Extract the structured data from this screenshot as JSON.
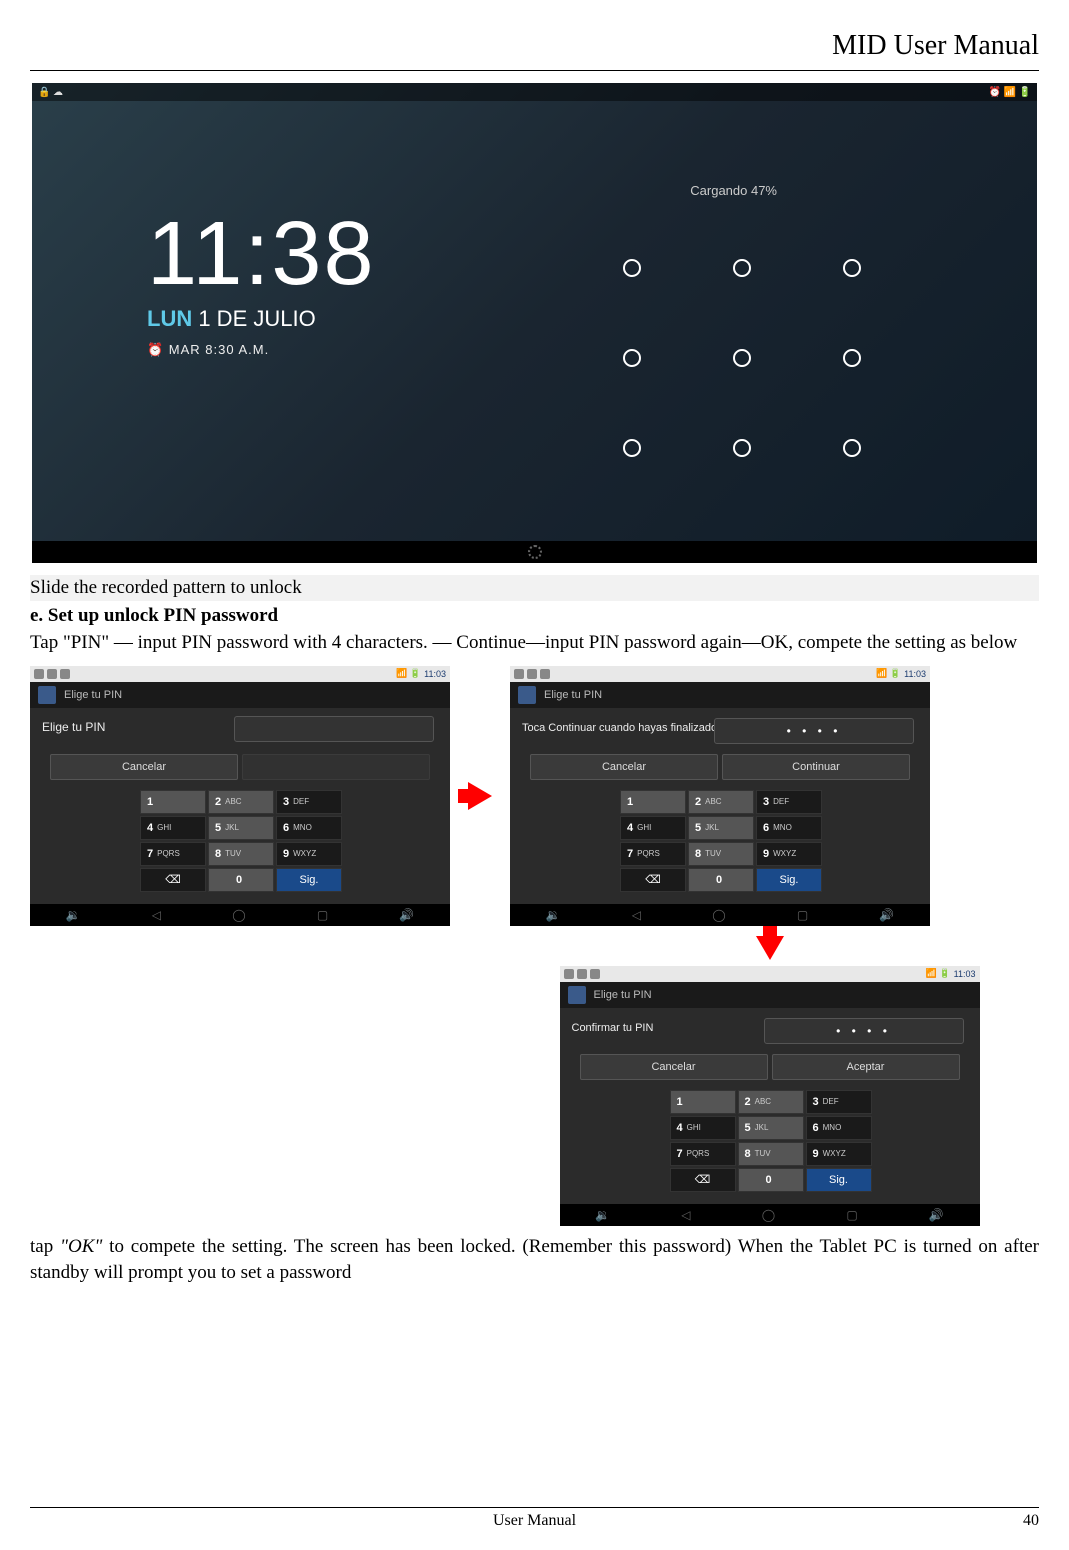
{
  "header_title": "MID User Manual",
  "lockscreen": {
    "time": "11:38",
    "day_prefix": "LUN",
    "date_rest": " 1 DE JULIO",
    "alarm": "⏰ MAR 8:30 A.M.",
    "charging": "Cargando 47%"
  },
  "body": {
    "slide_text": "Slide the recorded pattern to unlock",
    "heading_e": "e. Set up unlock PIN password",
    "para1": "Tap \"PIN\" — input PIN password with 4 characters. — Continue—input PIN password again—OK, compete the setting as below",
    "para2_pre": "tap ",
    "para2_em": "\"OK\"",
    "para2_post": " to compete the setting. The screen has been locked. (Remember this password) When the Tablet PC is turned on after standby will prompt you to set a password"
  },
  "pin": {
    "topbar_time": "11:03",
    "crumb": "Elige tu PIN",
    "label_a": "Elige tu PIN",
    "msg_b": "Toca Continuar cuando hayas finalizado",
    "msg_c": "Confirmar tu PIN",
    "dots": "• • • •",
    "btns": {
      "cancel": "Cancelar",
      "continue": "Continuar",
      "accept": "Aceptar"
    },
    "keys": {
      "k1": "1",
      "k2": "2",
      "k2l": "ABC",
      "k3": "3",
      "k3l": "DEF",
      "k4": "4",
      "k4l": "GHI",
      "k5": "5",
      "k5l": "JKL",
      "k6": "6",
      "k6l": "MNO",
      "k7": "7",
      "k7l": "PQRS",
      "k8": "8",
      "k8l": "TUV",
      "k9": "9",
      "k9l": "WXYZ",
      "k0": "0",
      "del": "⌫",
      "next": "Sig."
    }
  },
  "footer": {
    "center": "User Manual",
    "page": "40"
  }
}
